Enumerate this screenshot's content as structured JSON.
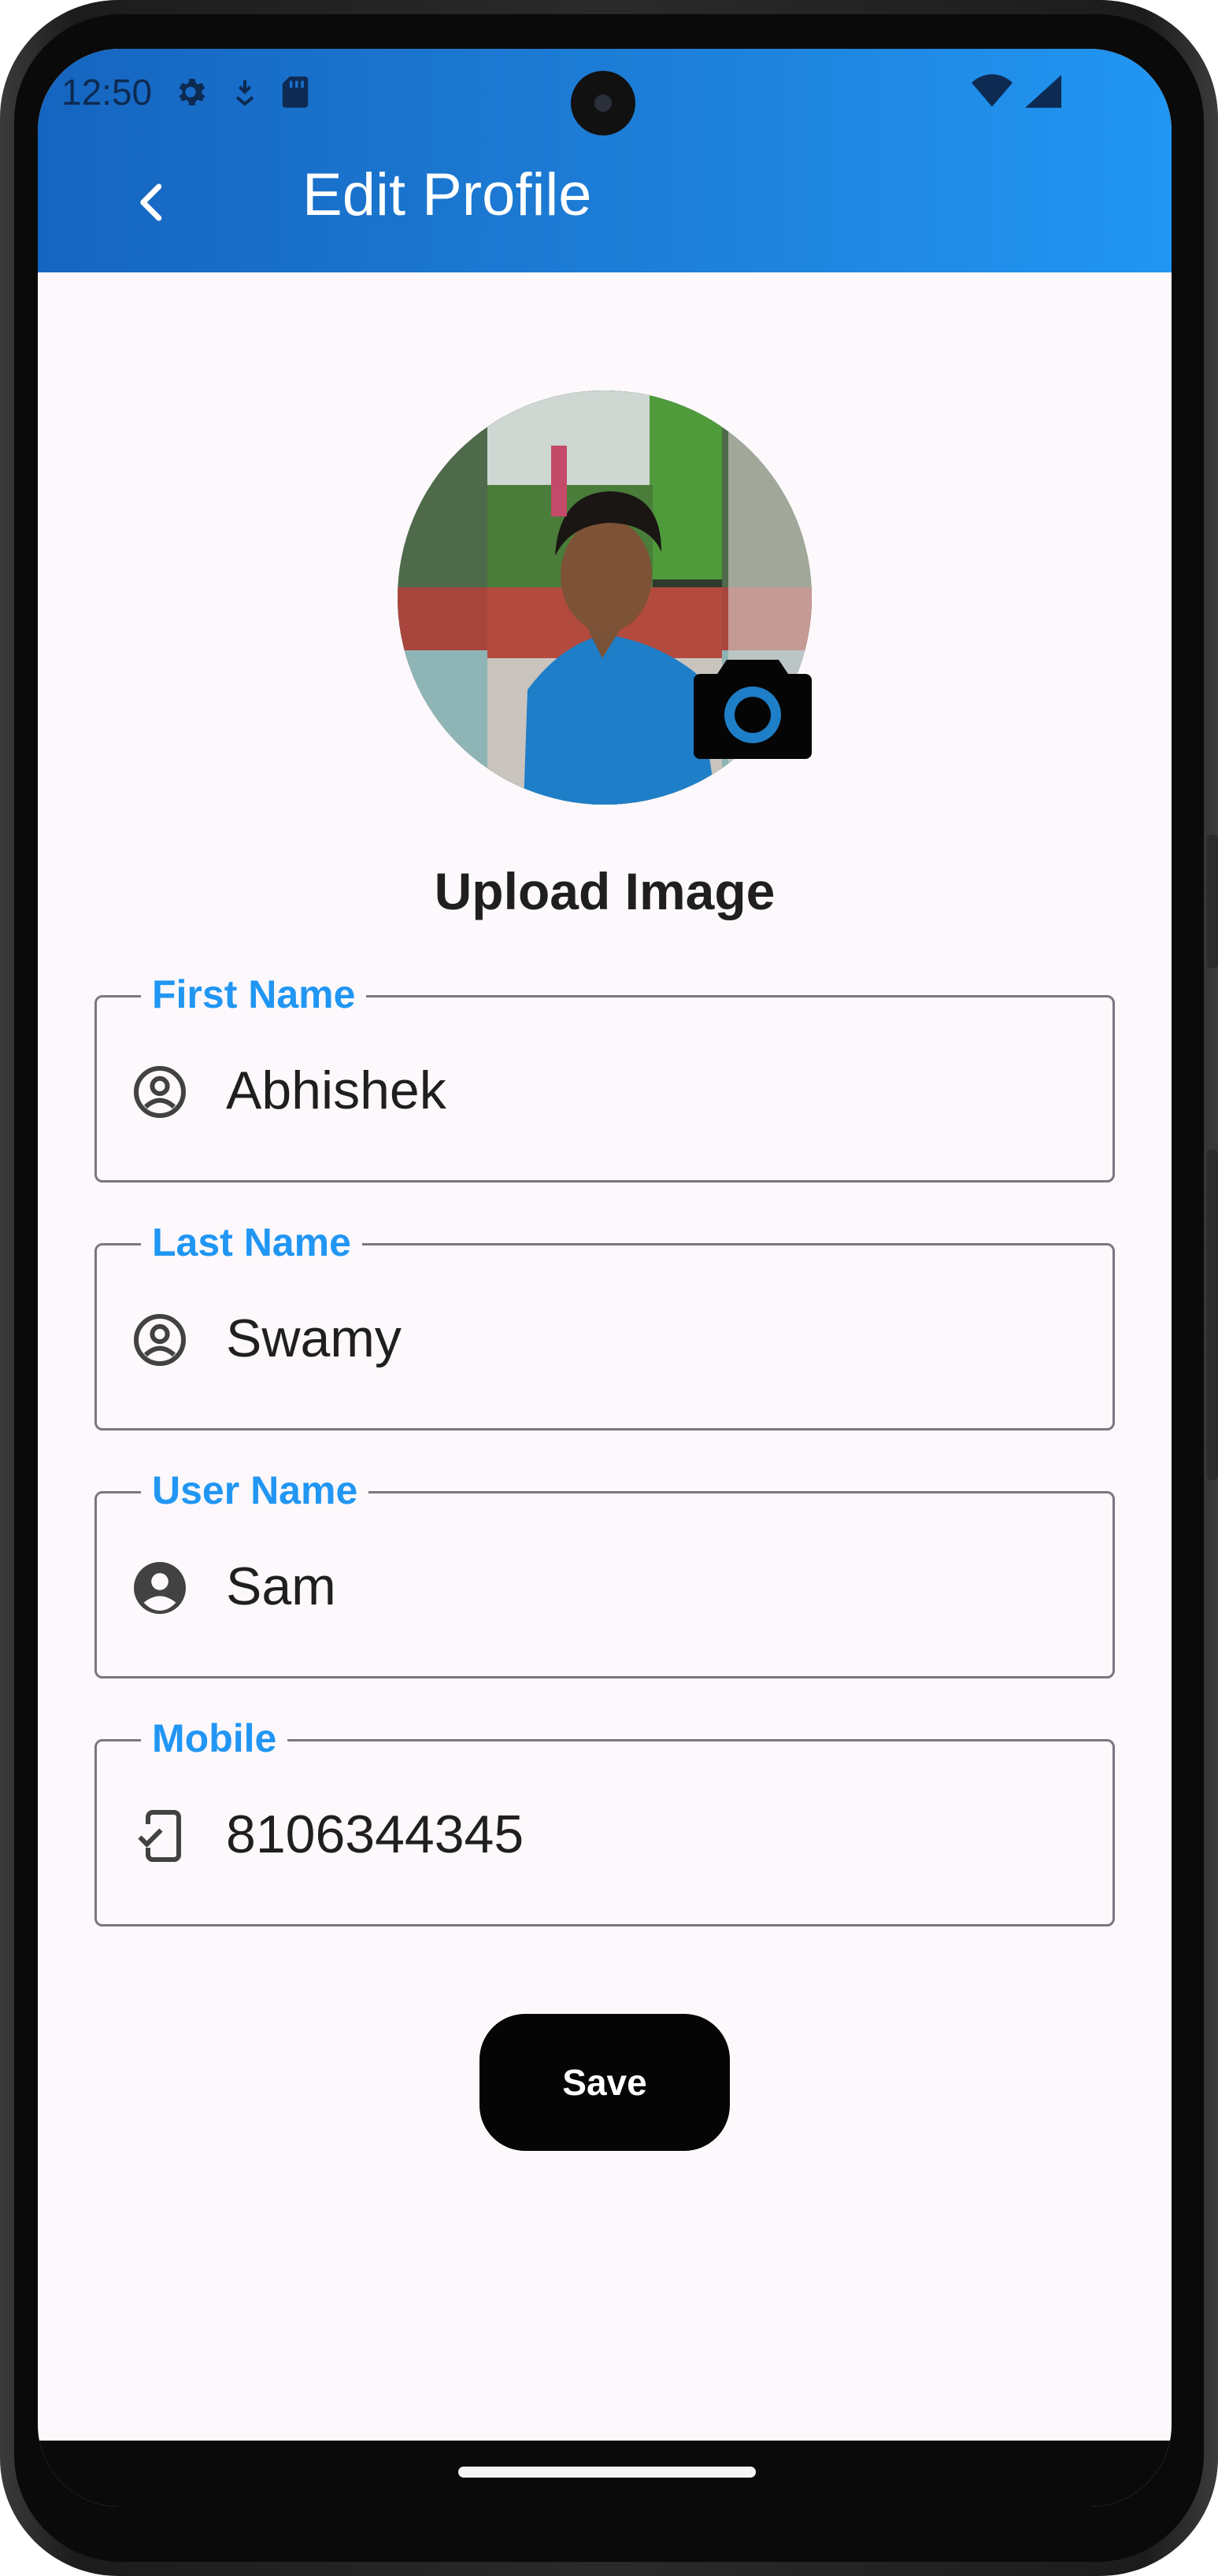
{
  "status_bar": {
    "time": "12:50",
    "icons_left": [
      "settings-icon",
      "download-icon",
      "sd-card-icon"
    ],
    "icons_right": [
      "wifi-icon",
      "signal-icon"
    ]
  },
  "app_bar": {
    "back_icon": "chevron-left-icon",
    "title": "Edit Profile",
    "gradient_colors": [
      "#1565c0",
      "#2196f3"
    ]
  },
  "profile": {
    "upload_label": "Upload Image",
    "camera_icon": "camera-icon"
  },
  "form": {
    "fields": [
      {
        "label": "First Name",
        "value": "Abhishek",
        "icon": "account-circle-outline-icon"
      },
      {
        "label": "Last Name",
        "value": "Swamy",
        "icon": "account-circle-outline-icon"
      },
      {
        "label": "User Name",
        "value": "Sam",
        "icon": "account-circle-filled-icon"
      },
      {
        "label": "Mobile",
        "value": "8106344345",
        "icon": "mobile-check-icon"
      }
    ],
    "label_color": "#2196f3",
    "border_color": "#7b7680"
  },
  "actions": {
    "save_label": "Save",
    "save_color": "#050505"
  }
}
